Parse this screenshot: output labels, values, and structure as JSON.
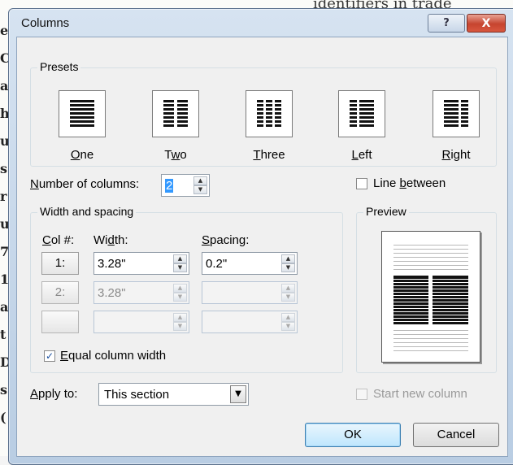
{
  "background": {
    "top_text": "identifiers  in  trade",
    "left_glyphs": [
      "e",
      "C",
      "a",
      "h",
      "u",
      "s",
      "r",
      "u",
      "7",
      "1",
      "a",
      "t",
      "D",
      "s",
      "("
    ]
  },
  "window": {
    "title": "Columns",
    "help_glyph": "?",
    "close_glyph": "X"
  },
  "presets": {
    "legend": "Presets",
    "items": [
      {
        "label_pre": "",
        "label_u": "O",
        "label_post": "ne"
      },
      {
        "label_pre": "T",
        "label_u": "w",
        "label_post": "o"
      },
      {
        "label_pre": "",
        "label_u": "T",
        "label_post": "hree"
      },
      {
        "label_pre": "",
        "label_u": "L",
        "label_post": "eft"
      },
      {
        "label_pre": "",
        "label_u": "R",
        "label_post": "ight"
      }
    ]
  },
  "num_columns": {
    "label_u": "N",
    "label_post": "umber of columns:",
    "value": "2"
  },
  "line_between": {
    "label_pre": "Line ",
    "label_u": "b",
    "label_post": "etween",
    "checked": false
  },
  "width_spacing": {
    "legend": "Width and spacing",
    "col_header_u": "C",
    "col_header_post": "ol #:",
    "width_header_pre": "Wi",
    "width_header_u": "d",
    "width_header_post": "th:",
    "spacing_header_u": "S",
    "spacing_header_post": "pacing:",
    "rows": [
      {
        "col": "1:",
        "width": "3.28\"",
        "spacing": "0.2\"",
        "enabled": true
      },
      {
        "col": "2:",
        "width": "3.28\"",
        "spacing": "",
        "enabled": false
      },
      {
        "col": "",
        "width": "",
        "spacing": "",
        "enabled": false
      }
    ],
    "equal_width": {
      "label_u": "E",
      "label_post": "qual column width",
      "checked": true,
      "check_glyph": "✓"
    }
  },
  "preview": {
    "legend": "Preview"
  },
  "apply_to": {
    "label_u": "A",
    "label_post": "pply to:",
    "value": "This section",
    "drop_glyph": "▼"
  },
  "start_new_column": {
    "label": "Start new column",
    "checked": false,
    "enabled": false
  },
  "buttons": {
    "ok": "OK",
    "cancel": "Cancel"
  },
  "colors": {
    "title_bar": "#c4d6ea",
    "close_button": "#c6442f",
    "default_button": "#3c7fb1"
  }
}
